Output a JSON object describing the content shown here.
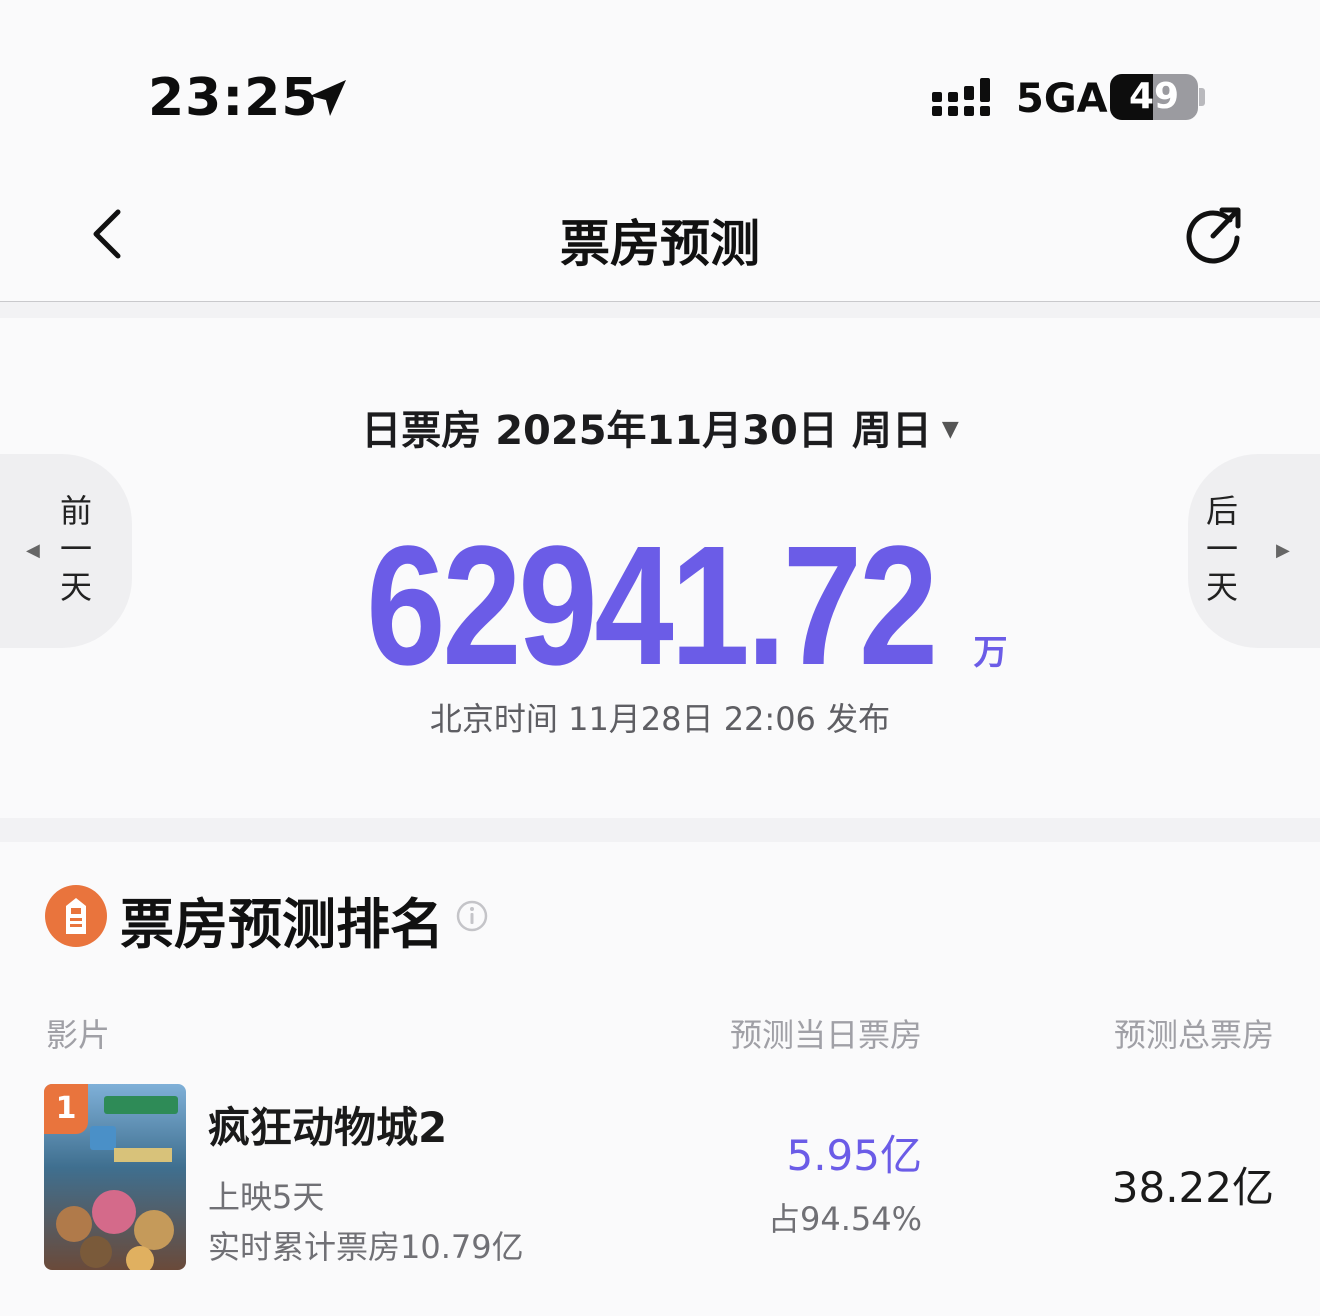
{
  "status_bar": {
    "time": "23:25",
    "network": "5GA",
    "battery_level": "49",
    "battery_fraction": 0.49,
    "icons": [
      "location-arrow-icon",
      "signal-icon",
      "battery-icon"
    ]
  },
  "nav": {
    "title": "票房预测",
    "icons": [
      "chevron-left-icon",
      "share-icon"
    ]
  },
  "summary": {
    "label": "日票房",
    "date": "2025年11月30日",
    "weekday": "周日",
    "prev_day": [
      "前",
      "一",
      "天"
    ],
    "next_day": [
      "后",
      "一",
      "天"
    ],
    "amount": "62941.72",
    "unit": "万",
    "published": "北京时间 11月28日 22:06 发布"
  },
  "ranking": {
    "title": "票房预测排名",
    "columns": {
      "film": "影片",
      "daily": "预测当日票房",
      "total": "预测总票房"
    },
    "films": [
      {
        "rank": "1",
        "title": "疯狂动物城2",
        "days": "上映5天",
        "cumulative": "实时累计票房10.79亿",
        "daily_forecast": "5.95亿",
        "share": "占94.54%",
        "total_forecast": "38.22亿"
      }
    ]
  },
  "colors": {
    "accent": "#6b5ce7",
    "rank_badge": "#e9743d",
    "muted": "#a0a0a6"
  }
}
